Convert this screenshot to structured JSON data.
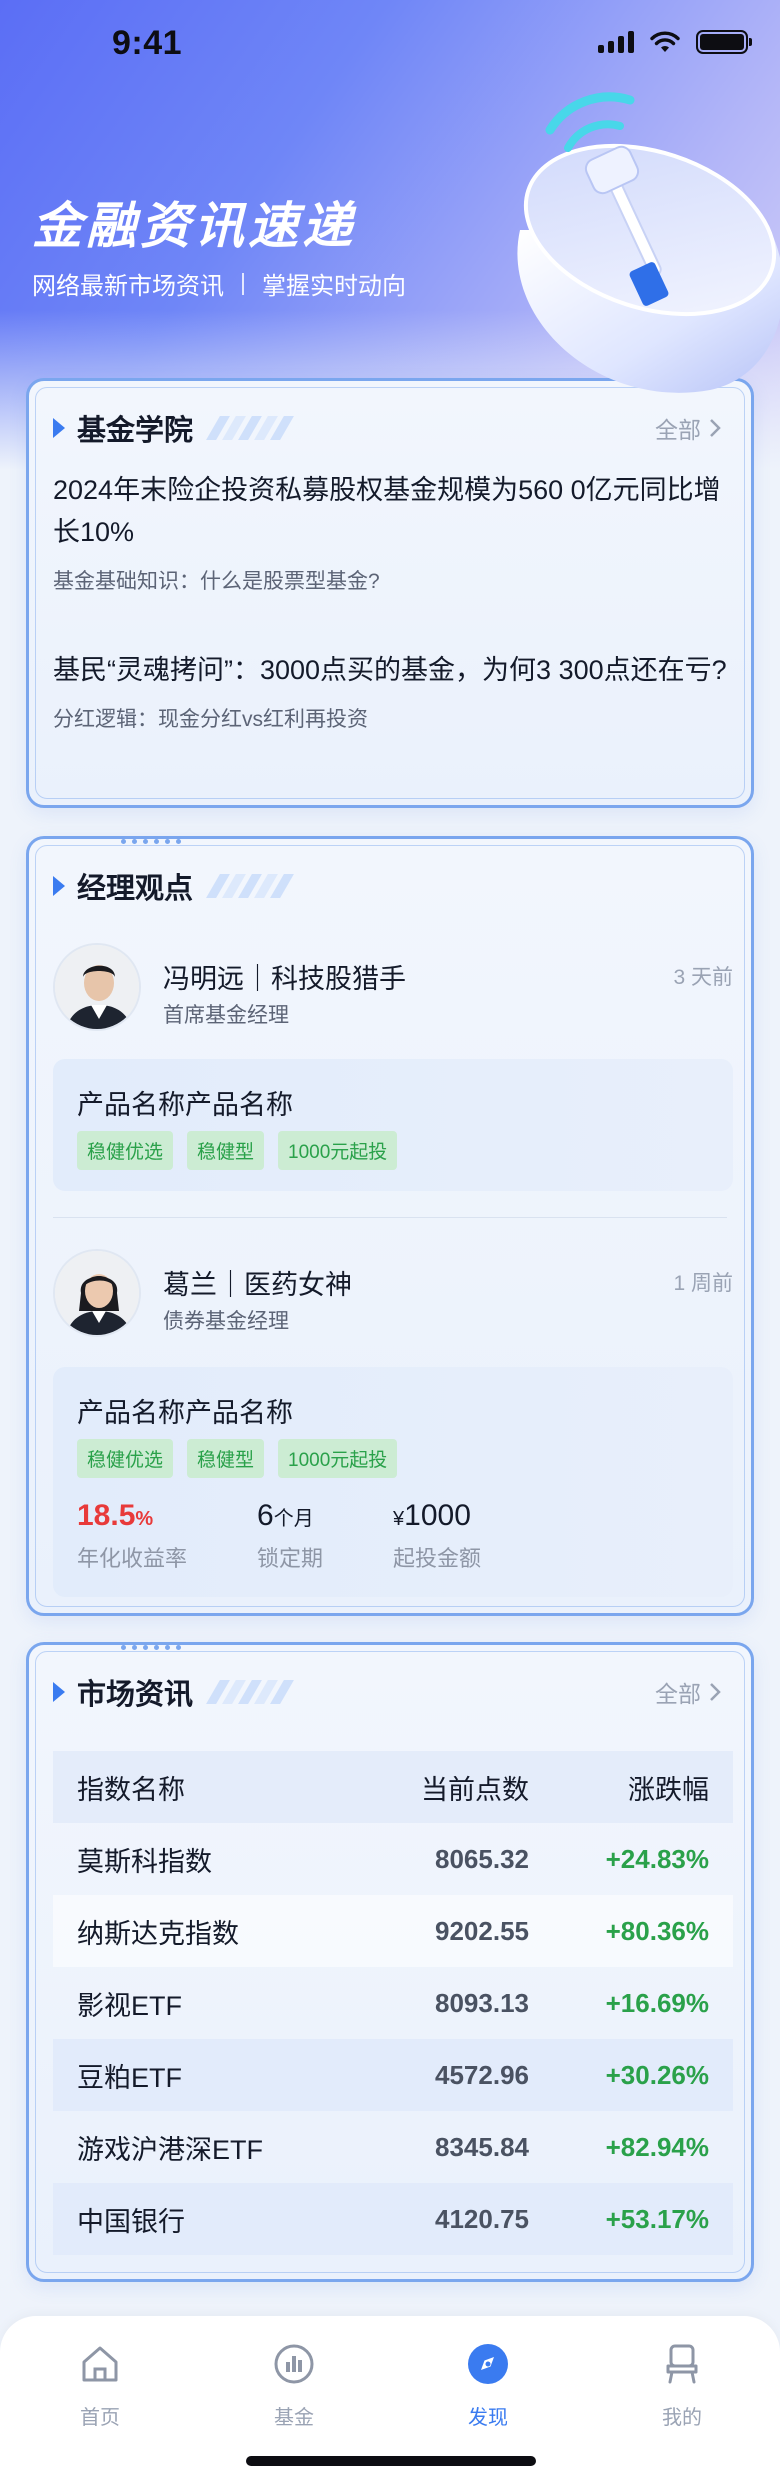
{
  "status_bar": {
    "time": "9:41"
  },
  "hero": {
    "title": "金融资讯速递",
    "subtitle_left": "网络最新市场资讯",
    "subtitle_right": "掌握实时动向"
  },
  "fund_academy": {
    "title": "基金学院",
    "more": "全部",
    "articles": [
      {
        "title": "2024年末险企投资私募股权基金规模为560 0亿元同比增长10%",
        "subtitle": "基金基础知识：什么是股票型基金?"
      },
      {
        "title": "基民“灵魂拷问”：3000点买的基金，为何3 300点还在亏?",
        "subtitle": "分红逻辑：现金分红vs红利再投资"
      }
    ]
  },
  "manager_views": {
    "title": "经理观点",
    "managers": [
      {
        "name": "冯明远｜科技股猎手",
        "role": "首席基金经理",
        "time": "3 天前",
        "product": {
          "name": "产品名称产品名称",
          "tags": [
            "稳健优选",
            "稳健型",
            "1000元起投"
          ]
        }
      },
      {
        "name": "葛兰｜医药女神",
        "role": "债券基金经理",
        "time": "1 周前",
        "product": {
          "name": "产品名称产品名称",
          "tags": [
            "稳健优选",
            "稳健型",
            "1000元起投"
          ],
          "stats": [
            {
              "value": "18.5",
              "unit": "%",
              "label": "年化收益率"
            },
            {
              "value": "6",
              "unit": "个月",
              "label": "锁定期"
            },
            {
              "prefix": "¥",
              "value": "1000",
              "label": "起投金额"
            }
          ]
        }
      }
    ]
  },
  "market_info": {
    "title": "市场资讯",
    "more": "全部",
    "columns": [
      "指数名称",
      "当前点数",
      "涨跌幅"
    ],
    "rows": [
      {
        "name": "莫斯科指数",
        "points": "8065.32",
        "change": "+24.83%"
      },
      {
        "name": "纳斯达克指数",
        "points": "9202.55",
        "change": "+80.36%"
      },
      {
        "name": "影视ETF",
        "points": "8093.13",
        "change": "+16.69%"
      },
      {
        "name": "豆粕ETF",
        "points": "4572.96",
        "change": "+30.26%"
      },
      {
        "name": "游戏沪港深ETF",
        "points": "8345.84",
        "change": "+82.94%"
      },
      {
        "name": "中国银行",
        "points": "4120.75",
        "change": "+53.17%"
      }
    ]
  },
  "tabbar": {
    "items": [
      {
        "label": "首页",
        "icon": "home-icon",
        "active": false
      },
      {
        "label": "基金",
        "icon": "fund-chart-icon",
        "active": false
      },
      {
        "label": "发现",
        "icon": "compass-icon",
        "active": true
      },
      {
        "label": "我的",
        "icon": "profile-icon",
        "active": false
      }
    ]
  },
  "colors": {
    "accent": "#3a7bf0",
    "up": "#2aa14a",
    "highlight": "#e83a3a"
  }
}
